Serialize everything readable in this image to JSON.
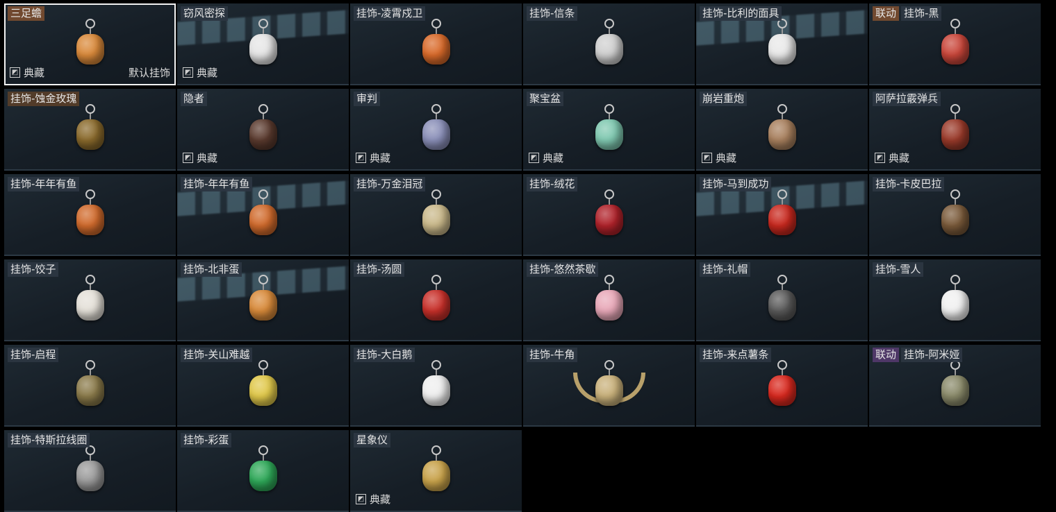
{
  "items": [
    {
      "tags": [
        "三足蟾"
      ],
      "tag_style": [
        "brown"
      ],
      "collect": "典藏",
      "default": "默认挂饰",
      "selected": true,
      "glow": false,
      "color": "#d9893a"
    },
    {
      "tags": [
        "窃风密探"
      ],
      "tag_style": [
        "plain"
      ],
      "collect": "典藏",
      "glow": true,
      "color": "#e5e5e5"
    },
    {
      "tags": [
        "挂饰-凌霄戍卫"
      ],
      "tag_style": [
        "plain"
      ],
      "glow": false,
      "color": "#d96a2a"
    },
    {
      "tags": [
        "挂饰-信条"
      ],
      "tag_style": [
        "plain"
      ],
      "glow": false,
      "color": "#cfcfcf"
    },
    {
      "tags": [
        "挂饰-比利的面具"
      ],
      "tag_style": [
        "plain"
      ],
      "glow": true,
      "color": "#e8e8e8"
    },
    {
      "tags": [
        "联动",
        "挂饰-黑"
      ],
      "tag_style": [
        "brown",
        "plain"
      ],
      "glow": false,
      "color": "#c9463a"
    },
    {
      "tags": [
        "挂饰-蚀金玫瑰"
      ],
      "tag_style": [
        "gold"
      ],
      "glow": false,
      "color": "#8a6a2c"
    },
    {
      "tags": [
        "隐者"
      ],
      "tag_style": [
        "plain"
      ],
      "collect": "典藏",
      "glow": false,
      "color": "#5a3a2e"
    },
    {
      "tags": [
        "审判"
      ],
      "tag_style": [
        "plain"
      ],
      "collect": "典藏",
      "glow": false,
      "color": "#8a8fb8"
    },
    {
      "tags": [
        "聚宝盆"
      ],
      "tag_style": [
        "plain"
      ],
      "collect": "典藏",
      "glow": false,
      "color": "#7fc8b0"
    },
    {
      "tags": [
        "崩岩重炮"
      ],
      "tag_style": [
        "plain"
      ],
      "collect": "典藏",
      "glow": false,
      "color": "#a8805e"
    },
    {
      "tags": [
        "阿萨拉霰弹兵"
      ],
      "tag_style": [
        "plain"
      ],
      "collect": "典藏",
      "glow": false,
      "color": "#9a3a2a"
    },
    {
      "tags": [
        "挂饰-年年有鱼"
      ],
      "tag_style": [
        "plain"
      ],
      "glow": false,
      "color": "#d06a2c"
    },
    {
      "tags": [
        "挂饰-年年有鱼"
      ],
      "tag_style": [
        "plain"
      ],
      "glow": true,
      "color": "#d06a2c"
    },
    {
      "tags": [
        "挂饰-万金泪冠"
      ],
      "tag_style": [
        "plain"
      ],
      "glow": false,
      "color": "#c9b88a"
    },
    {
      "tags": [
        "挂饰-绒花"
      ],
      "tag_style": [
        "plain"
      ],
      "glow": false,
      "color": "#b0222a"
    },
    {
      "tags": [
        "挂饰-马到成功"
      ],
      "tag_style": [
        "plain"
      ],
      "glow": true,
      "color": "#c8281e"
    },
    {
      "tags": [
        "挂饰-卡皮巴拉"
      ],
      "tag_style": [
        "plain"
      ],
      "glow": false,
      "color": "#7a5a3a"
    },
    {
      "tags": [
        "挂饰-饺子"
      ],
      "tag_style": [
        "plain"
      ],
      "glow": false,
      "color": "#e4e0d8"
    },
    {
      "tags": [
        "挂饰-北非蛋"
      ],
      "tag_style": [
        "plain"
      ],
      "glow": true,
      "color": "#d88a3a"
    },
    {
      "tags": [
        "挂饰-汤圆"
      ],
      "tag_style": [
        "plain"
      ],
      "glow": false,
      "color": "#c8302a"
    },
    {
      "tags": [
        "挂饰-悠然茶歇"
      ],
      "tag_style": [
        "plain"
      ],
      "glow": false,
      "color": "#e8a8b8"
    },
    {
      "tags": [
        "挂饰-礼帽"
      ],
      "tag_style": [
        "plain"
      ],
      "glow": false,
      "color": "#5a5a5a"
    },
    {
      "tags": [
        "挂饰-雪人"
      ],
      "tag_style": [
        "plain"
      ],
      "glow": false,
      "color": "#f0f0f0"
    },
    {
      "tags": [
        "挂饰-启程"
      ],
      "tag_style": [
        "plain"
      ],
      "glow": false,
      "color": "#8a7a4a"
    },
    {
      "tags": [
        "挂饰-关山难越"
      ],
      "tag_style": [
        "plain"
      ],
      "glow": false,
      "color": "#e0c84a"
    },
    {
      "tags": [
        "挂饰-大白鹅"
      ],
      "tag_style": [
        "plain"
      ],
      "glow": false,
      "color": "#eeeeee"
    },
    {
      "tags": [
        "挂饰-牛角"
      ],
      "tag_style": [
        "plain"
      ],
      "glow": false,
      "color": "#c8b07a",
      "horns": true
    },
    {
      "tags": [
        "挂饰-来点薯条"
      ],
      "tag_style": [
        "plain"
      ],
      "glow": false,
      "color": "#d8281e"
    },
    {
      "tags": [
        "联动",
        "挂饰-阿米娅"
      ],
      "tag_style": [
        "purple",
        "plain"
      ],
      "glow": false,
      "color": "#8a8a6a"
    },
    {
      "tags": [
        "挂饰-特斯拉线圈"
      ],
      "tag_style": [
        "plain"
      ],
      "glow": false,
      "color": "#9a9a9a"
    },
    {
      "tags": [
        "挂饰-彩蛋"
      ],
      "tag_style": [
        "plain"
      ],
      "glow": false,
      "color": "#2ea858"
    },
    {
      "tags": [
        "星象仪"
      ],
      "tag_style": [
        "plain"
      ],
      "collect": "典藏",
      "glow": false,
      "color": "#c8a24a"
    }
  ],
  "icons": {
    "collect": "collection-icon",
    "charm": "charm-icon"
  }
}
